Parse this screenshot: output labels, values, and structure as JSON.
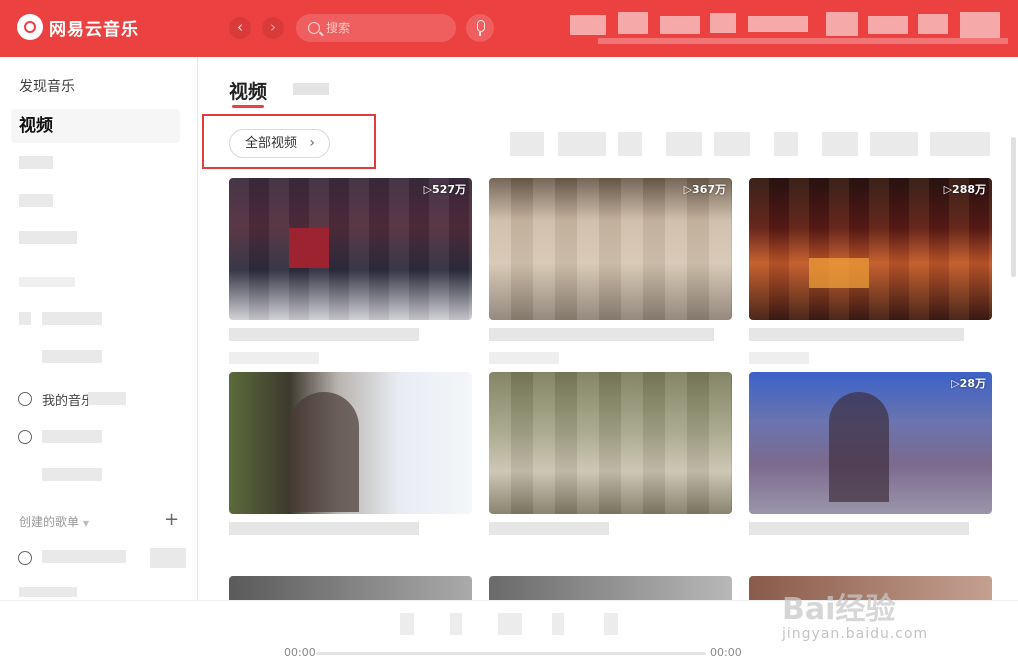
{
  "app": {
    "title": "网易云音乐"
  },
  "header": {
    "back_icon": "chevron-left-icon",
    "forward_icon": "chevron-right-icon",
    "search_placeholder": "搜索",
    "mic_icon": "microphone-icon",
    "accent_color": "#ec4141"
  },
  "sidebar": {
    "items": [
      {
        "label": "发现音乐"
      },
      {
        "label": "视频",
        "active": true
      }
    ],
    "my_music_label": "我的音乐",
    "created_playlists_label": "创建的歌单",
    "add_icon": "plus-icon"
  },
  "main": {
    "tab_active": "视频",
    "all_videos_label": "全部视频",
    "all_videos_chevron": "›",
    "videos": [
      {
        "plays": "▷527万"
      },
      {
        "plays": "▷367万"
      },
      {
        "plays": "▷288万"
      },
      {
        "plays": ""
      },
      {
        "plays": ""
      },
      {
        "plays": "▷28万"
      }
    ]
  },
  "player": {
    "time_current": "00:00",
    "time_total": "00:00",
    "progress": 0
  },
  "watermark": {
    "brand": "Bai经验",
    "url": "jingyan.baidu.com"
  }
}
